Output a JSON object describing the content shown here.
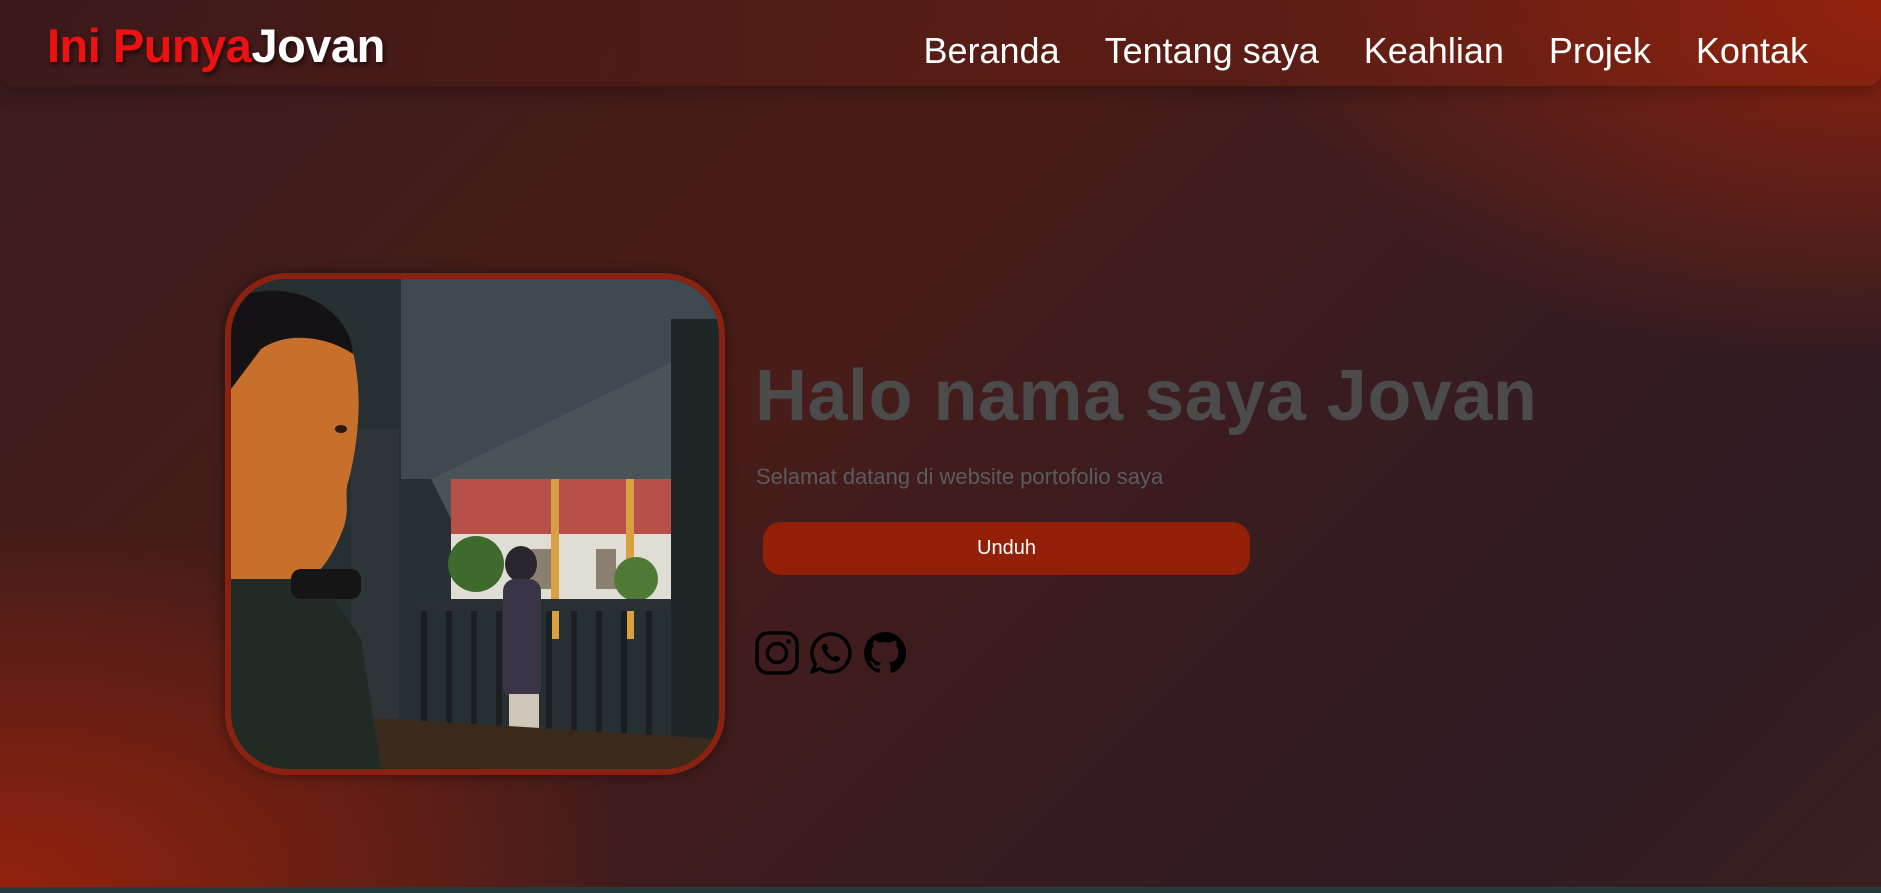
{
  "header": {
    "logo_part1": "Ini Punya",
    "logo_part2": "Jovan",
    "nav": [
      {
        "label": "Beranda"
      },
      {
        "label": "Tentang saya"
      },
      {
        "label": "Keahlian"
      },
      {
        "label": "Projek"
      },
      {
        "label": "Kontak"
      }
    ]
  },
  "hero": {
    "title": "Halo nama saya Jovan",
    "subtitle": "Selamat datang di website portofolio saya",
    "download_label": "Unduh",
    "socials": [
      {
        "icon": "instagram-icon"
      },
      {
        "icon": "whatsapp-icon"
      },
      {
        "icon": "github-icon"
      }
    ]
  },
  "colors": {
    "logo_accent": "#ee1111",
    "button": "#922008",
    "frame_border": "#8a2212",
    "headline": "#4b4b4b"
  }
}
